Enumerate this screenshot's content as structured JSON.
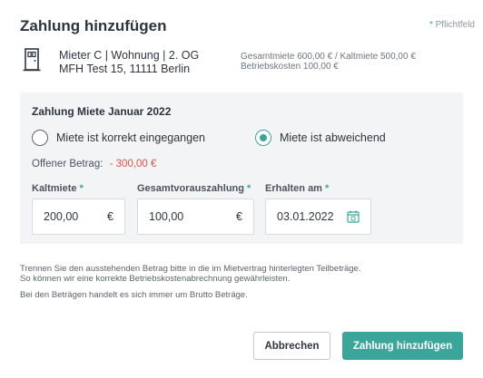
{
  "dialog": {
    "title": "Zahlung hinzufügen",
    "required_star": "*",
    "required_label": "Pflichtfeld"
  },
  "tenant": {
    "icon": "door-icon",
    "line1": "Mieter C | Wohnung | 2. OG",
    "line2": "MFH Test 15, 11111 Berlin",
    "rent_line1": "Gesamtmiete 600,00 € / Kaltmiete 500,00 €",
    "rent_line2": "Betriebskosten 100,00 €"
  },
  "payment": {
    "section_title": "Zahlung Miete Januar 2022",
    "options": [
      {
        "label": "Miete ist korrekt eingegangen",
        "selected": false
      },
      {
        "label": "Miete ist abweichend",
        "selected": true
      }
    ],
    "open_label": "Offener Betrag:",
    "open_amount": "- 300,00 €",
    "fields": {
      "kaltmiete": {
        "label": "Kaltmiete",
        "star": "*",
        "value": "200,00",
        "currency": "€"
      },
      "vorauszahlung": {
        "label": "Gesamtvorauszahlung",
        "star": "*",
        "value": "100,00",
        "currency": "€"
      },
      "erhalten": {
        "label": "Erhalten am",
        "star": "*",
        "value": "03.01.2022",
        "icon": "calendar-icon"
      }
    }
  },
  "hints": {
    "line1": "Trennen Sie den ausstehenden Betrag bitte in die im Mietvertrag hinterlegten Teilbeträge.",
    "line2": "So können wir eine korrekte Betriebskostenabrechnung gewährleisten.",
    "line3": "Bei den Beträgen handelt es sich immer um Brutto Beträge."
  },
  "buttons": {
    "cancel": "Abbrechen",
    "submit": "Zahlung hinzufügen"
  },
  "colors": {
    "accent": "#3ca59a",
    "negative": "#e0524a",
    "panel_bg": "#f3f4f6"
  }
}
